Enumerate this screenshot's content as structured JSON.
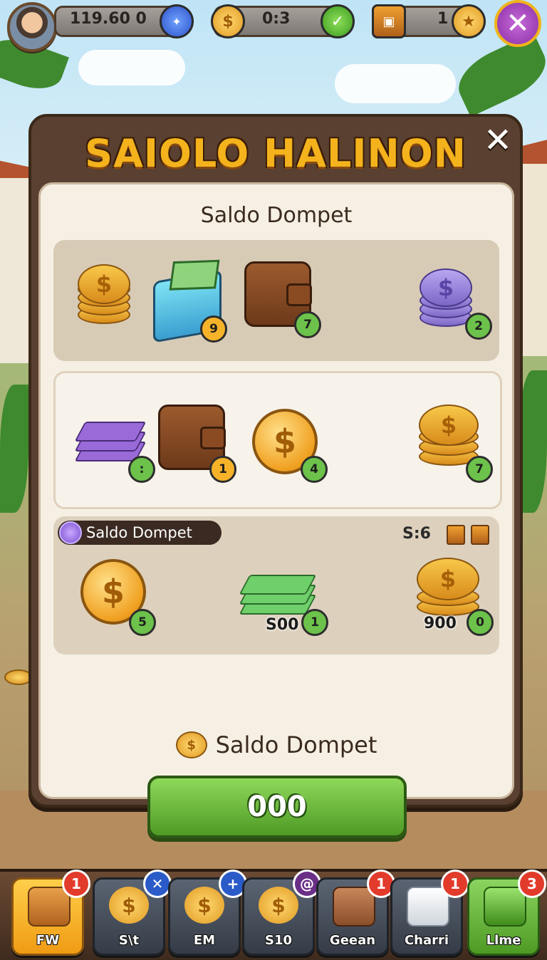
{
  "hud": {
    "coins_value": "119.60 0",
    "timer_value": "0:3",
    "level_value": "1",
    "star_icon": "star-icon",
    "check_icon": "check-icon"
  },
  "modal": {
    "title": "SAIOLO HALINON",
    "close_glyph": "✕",
    "header": "Saldo Dompet"
  },
  "row1": {
    "items": [
      {
        "name": "gold-coin-stack",
        "count": ""
      },
      {
        "name": "cash-bundle",
        "count": "9"
      },
      {
        "name": "wallet",
        "count": "7"
      },
      {
        "name": "purple-coin-stack",
        "count": "2"
      }
    ]
  },
  "row2": {
    "items": [
      {
        "name": "purple-gem-stack",
        "count": ":"
      },
      {
        "name": "wallet-cash",
        "count": "1"
      },
      {
        "name": "gold-coin",
        "count": "4"
      },
      {
        "name": "gold-coin-stack",
        "count": "7"
      }
    ]
  },
  "row3": {
    "pill_label": "Saldo Dompet",
    "tag": "S:6",
    "items": [
      {
        "name": "gold-coin",
        "count": "5",
        "amount": ""
      },
      {
        "name": "green-cash-stack",
        "count": "1",
        "amount": "S00"
      },
      {
        "name": "gold-coin-stack",
        "count": "0",
        "amount": "900"
      }
    ]
  },
  "footer": {
    "label": "Saldo Dompet",
    "button_label": "000"
  },
  "nav": [
    {
      "label": "FW",
      "badge": "1"
    },
    {
      "label": "S\\t",
      "badge": "✕"
    },
    {
      "label": "EM",
      "badge": "+"
    },
    {
      "label": "S10",
      "badge": "@"
    },
    {
      "label": "Geean",
      "badge": "1"
    },
    {
      "label": "Charri",
      "badge": "1"
    },
    {
      "label": "Llme",
      "badge": "3"
    }
  ],
  "colors": {
    "title_gold": "#f4b31c",
    "button_green": "#6cc24a",
    "badge_red": "#e23b2b"
  }
}
